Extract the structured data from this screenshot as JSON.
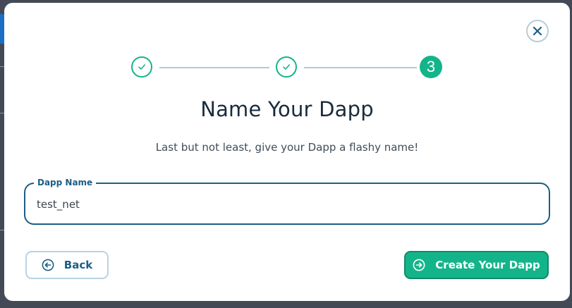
{
  "modal": {
    "title": "Name Your Dapp",
    "subtitle": "Last but not least, give your Dapp a flashy name!",
    "close_icon": "close-icon"
  },
  "stepper": {
    "steps": [
      {
        "state": "complete",
        "icon": "check-icon"
      },
      {
        "state": "complete",
        "icon": "check-icon"
      },
      {
        "state": "active",
        "number": "3"
      }
    ]
  },
  "form": {
    "dapp_name": {
      "label": "Dapp Name",
      "value": "test_net"
    }
  },
  "actions": {
    "back_label": "Back",
    "back_icon": "arrow-left-circle-icon",
    "create_label": "Create Your Dapp",
    "create_icon": "arrow-right-circle-icon"
  },
  "colors": {
    "accent": "#14b48a",
    "primary": "#1c5e85",
    "connector": "#b5cad6",
    "backdrop": "#434a55"
  }
}
